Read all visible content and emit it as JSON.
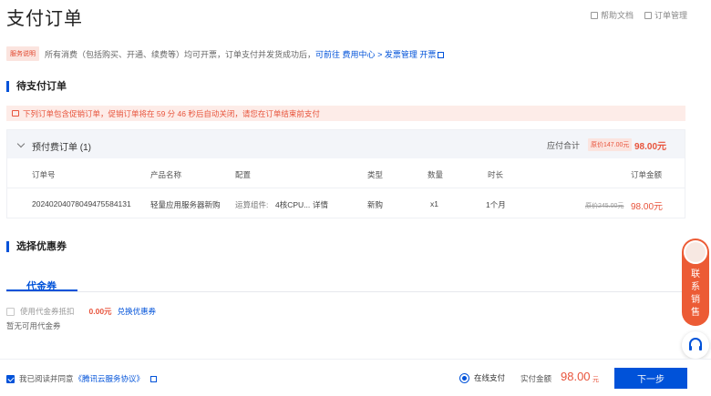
{
  "header": {
    "title": "支付订单",
    "help_doc": "帮助文档",
    "order_manage": "订单管理"
  },
  "service_note": {
    "badge": "服务说明",
    "text": "所有消费（包括购买、开通、续费等）均可开票，订单支付并发货成功后，",
    "link_prefix": "可前往",
    "link_fee_center": "费用中心",
    "separator": ">",
    "link_invoice": "发票管理",
    "link_open": "开票"
  },
  "pending": {
    "section_title": "待支付订单",
    "warning": "下列订单包含促销订单，促销订单将在 59 分 46 秒后自动关闭，请您在订单结束前支付",
    "group_label": "预付费订单 (1)",
    "sum_label": "应付合计",
    "orig_pill": "原价147.00元",
    "sum_price": "98.00元",
    "columns": [
      "订单号",
      "产品名称",
      "配置",
      "类型",
      "数量",
      "时长",
      "订单金额"
    ],
    "rows": [
      {
        "order_no": "20240204078049475584131",
        "product": "轻量应用服务器新购",
        "config_label": "运算组件:",
        "config_value": "4核CPU...",
        "config_link": "详情",
        "type": "新购",
        "quantity": "x1",
        "duration": "1个月",
        "orig_price": "原价245.00元",
        "price": "98.00元"
      }
    ]
  },
  "coupon": {
    "section_title": "选择优惠券",
    "tab": "代金券",
    "use_label": "使用代金券抵扣",
    "amount": "0.00元",
    "exchange_link": "兑换优惠券",
    "empty": "暂无可用代金券"
  },
  "footer": {
    "agree_text": "我已阅读并同意",
    "agreement_link": "《腾讯云服务协议》",
    "pay_method": "在线支付",
    "paid_label": "实付金额",
    "paid_amount": "98.00",
    "paid_unit": "元",
    "next_button": "下一步"
  },
  "side": {
    "contact_sales": "联系销售"
  },
  "colors": {
    "accent": "#0052d9",
    "warning": "#e8543c",
    "side_panel": "#ec5b35"
  }
}
